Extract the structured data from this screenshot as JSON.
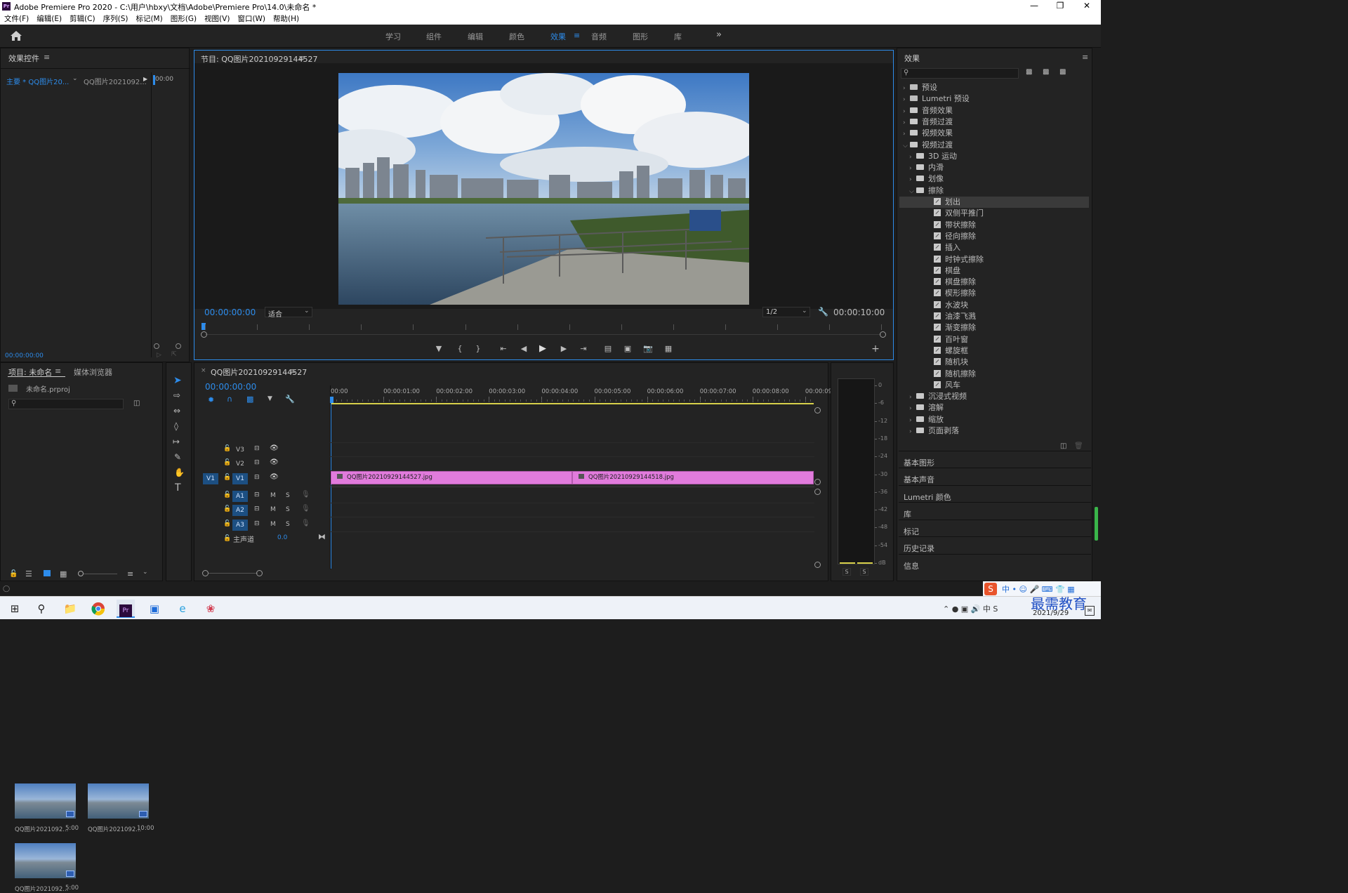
{
  "window": {
    "title": "Adobe Premiere Pro 2020 - C:\\用户\\hbxy\\文档\\Adobe\\Premiere Pro\\14.0\\未命名 *",
    "app_icon": "Pr"
  },
  "menu": [
    "文件(F)",
    "编辑(E)",
    "剪辑(C)",
    "序列(S)",
    "标记(M)",
    "图形(G)",
    "视图(V)",
    "窗口(W)",
    "帮助(H)"
  ],
  "workspaces": [
    {
      "label": "学习",
      "active": false
    },
    {
      "label": "组件",
      "active": false
    },
    {
      "label": "编辑",
      "active": false
    },
    {
      "label": "颜色",
      "active": false
    },
    {
      "label": "效果",
      "active": true
    },
    {
      "label": "音频",
      "active": false
    },
    {
      "label": "图形",
      "active": false
    },
    {
      "label": "库",
      "active": false
    }
  ],
  "effect_controls": {
    "title": "效果控件",
    "master": "主要 * QQ图片20...",
    "clip": "QQ图片2021092...",
    "time_mark": "00:00",
    "timecode": "00:00:00:00"
  },
  "project": {
    "tab_project": "项目: 未命名",
    "tab_media": "媒体浏览器",
    "file": "未命名.prproj",
    "items": [
      {
        "name": "QQ图片2021092...",
        "duration": "5:00"
      },
      {
        "name": "QQ图片2021092...",
        "duration": "10:00"
      },
      {
        "name": "QQ图片2021092...",
        "duration": "5:00"
      }
    ]
  },
  "program": {
    "title": "节目: QQ图片20210929144527",
    "timecode_current": "00:00:00:00",
    "fit": "适合",
    "resolution": "1/2",
    "timecode_duration": "00:00:10:00"
  },
  "timeline": {
    "title": "QQ图片20210929144527",
    "timecode": "00:00:00:00",
    "ruler": [
      "00:00",
      "00:00:01:00",
      "00:00:02:00",
      "00:00:03:00",
      "00:00:04:00",
      "00:00:05:00",
      "00:00:06:00",
      "00:00:07:00",
      "00:00:08:00",
      "00:00:09:"
    ],
    "video_tracks": [
      "V3",
      "V2",
      "V1"
    ],
    "source_patch": "V1",
    "audio_tracks": [
      "A1",
      "A2",
      "A3"
    ],
    "mute": "M",
    "solo": "S",
    "master": "主声道",
    "master_value": "0.0",
    "clips": [
      {
        "name": "QQ图片20210929144527.jpg",
        "start": 0,
        "end": 5
      },
      {
        "name": "QQ图片20210929144518.jpg",
        "start": 5,
        "end": 10
      }
    ]
  },
  "meter": {
    "scale": [
      "0",
      "-6",
      "-12",
      "-18",
      "-24",
      "-30",
      "-36",
      "-42",
      "-48",
      "-54",
      "dB"
    ],
    "solo_l": "S",
    "solo_r": "S"
  },
  "effects": {
    "title": "效果",
    "tree": [
      {
        "label": "预设",
        "level": 0,
        "kind": "bin",
        "expanded": false
      },
      {
        "label": "Lumetri 预设",
        "level": 0,
        "kind": "bin",
        "expanded": false
      },
      {
        "label": "音频效果",
        "level": 0,
        "kind": "folder",
        "expanded": false
      },
      {
        "label": "音频过渡",
        "level": 0,
        "kind": "folder",
        "expanded": false
      },
      {
        "label": "视频效果",
        "level": 0,
        "kind": "folder",
        "expanded": false
      },
      {
        "label": "视频过渡",
        "level": 0,
        "kind": "folder",
        "expanded": true
      },
      {
        "label": "3D 运动",
        "level": 1,
        "kind": "folder",
        "expanded": false
      },
      {
        "label": "内滑",
        "level": 1,
        "kind": "folder",
        "expanded": false
      },
      {
        "label": "划像",
        "level": 1,
        "kind": "folder",
        "expanded": false
      },
      {
        "label": "擦除",
        "level": 1,
        "kind": "folder",
        "expanded": true
      },
      {
        "label": "划出",
        "level": 2,
        "kind": "fx",
        "selected": true
      },
      {
        "label": "双侧平推门",
        "level": 2,
        "kind": "fx"
      },
      {
        "label": "带状擦除",
        "level": 2,
        "kind": "fx"
      },
      {
        "label": "径向擦除",
        "level": 2,
        "kind": "fx"
      },
      {
        "label": "插入",
        "level": 2,
        "kind": "fx"
      },
      {
        "label": "时钟式擦除",
        "level": 2,
        "kind": "fx"
      },
      {
        "label": "棋盘",
        "level": 2,
        "kind": "fx"
      },
      {
        "label": "棋盘擦除",
        "level": 2,
        "kind": "fx"
      },
      {
        "label": "楔形擦除",
        "level": 2,
        "kind": "fx"
      },
      {
        "label": "水波块",
        "level": 2,
        "kind": "fx"
      },
      {
        "label": "油漆飞溅",
        "level": 2,
        "kind": "fx"
      },
      {
        "label": "渐变擦除",
        "level": 2,
        "kind": "fx"
      },
      {
        "label": "百叶窗",
        "level": 2,
        "kind": "fx"
      },
      {
        "label": "螺旋框",
        "level": 2,
        "kind": "fx"
      },
      {
        "label": "随机块",
        "level": 2,
        "kind": "fx"
      },
      {
        "label": "随机擦除",
        "level": 2,
        "kind": "fx"
      },
      {
        "label": "风车",
        "level": 2,
        "kind": "fx"
      },
      {
        "label": "沉浸式视频",
        "level": 1,
        "kind": "folder",
        "expanded": false
      },
      {
        "label": "溶解",
        "level": 1,
        "kind": "folder",
        "expanded": false
      },
      {
        "label": "缩放",
        "level": 1,
        "kind": "folder",
        "expanded": false
      },
      {
        "label": "页面剥落",
        "level": 1,
        "kind": "folder",
        "expanded": false
      }
    ],
    "sections": [
      "基本图形",
      "基本声音",
      "Lumetri 颜色",
      "库",
      "标记",
      "历史记录",
      "信息"
    ]
  },
  "taskbar": {
    "date": "2021/9/29",
    "watermark": "最需教育"
  },
  "colors": {
    "accent": "#2d8ceb",
    "clip": "#e17bdc",
    "playhead": "#2d8ceb",
    "workarea": "#d7d04a"
  }
}
